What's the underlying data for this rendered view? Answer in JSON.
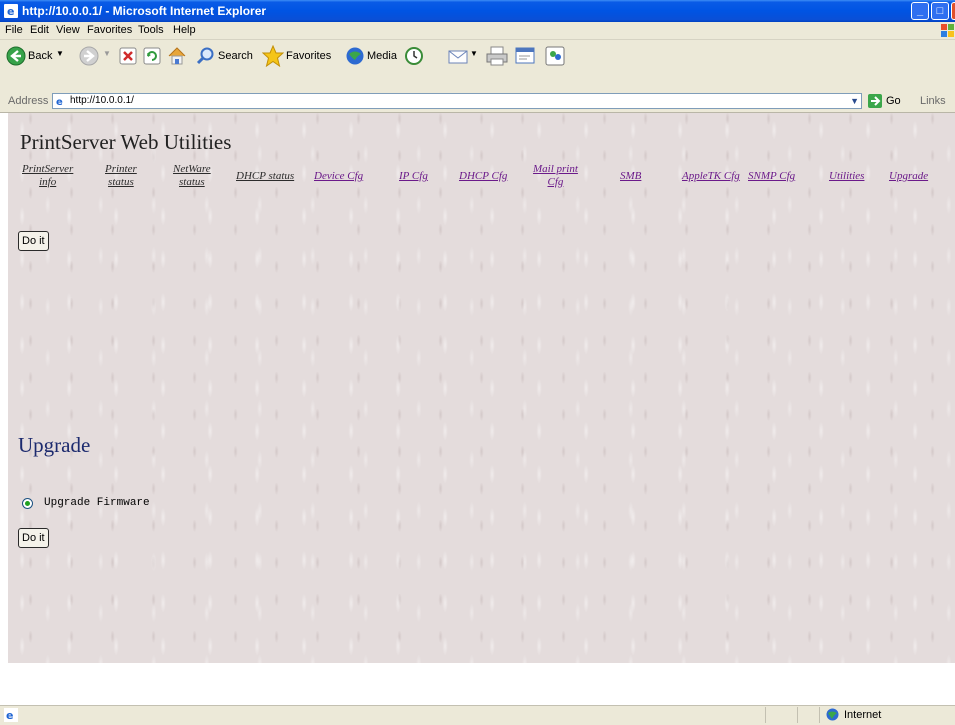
{
  "window": {
    "title": "http://10.0.0.1/ - Microsoft Internet Explorer",
    "buttons": {
      "minimize": "_",
      "maximize": "□",
      "close": "X"
    }
  },
  "menu": [
    "File",
    "Edit",
    "View",
    "Favorites",
    "Tools",
    "Help"
  ],
  "toolbar": {
    "back": "Back",
    "search": "Search",
    "favorites": "Favorites",
    "media": "Media",
    "icons": [
      "back-arrow-icon",
      "forward-arrow-icon",
      "stop-icon",
      "refresh-icon",
      "home-icon",
      "search-icon",
      "favorites-star-icon",
      "media-icon",
      "history-icon",
      "mail-icon",
      "print-icon",
      "edit-icon",
      "messenger-icon"
    ]
  },
  "address": {
    "label": "Address",
    "value": "http://10.0.0.1/",
    "go": "Go",
    "links": "Links"
  },
  "page": {
    "title": "PrintServer  Web  Utilities",
    "nav": [
      {
        "label_lines": [
          "PrintServer",
          "info"
        ],
        "visited": true
      },
      {
        "label_lines": [
          "Printer",
          "status"
        ],
        "visited": true
      },
      {
        "label_lines": [
          "NetWare",
          "status"
        ],
        "visited": true
      },
      {
        "label_lines": [
          "DHCP status"
        ],
        "visited": true
      },
      {
        "label_lines": [
          "Device Cfg"
        ],
        "visited": false
      },
      {
        "label_lines": [
          "IP Cfg"
        ],
        "visited": false
      },
      {
        "label_lines": [
          "DHCP Cfg"
        ],
        "visited": false
      },
      {
        "label_lines": [
          "Mail print",
          "Cfg"
        ],
        "visited": false
      },
      {
        "label_lines": [
          "SMB"
        ],
        "visited": false
      },
      {
        "label_lines": [
          "AppleTK Cfg"
        ],
        "visited": false
      },
      {
        "label_lines": [
          "SNMP Cfg"
        ],
        "visited": false
      },
      {
        "label_lines": [
          "Utilities"
        ],
        "visited": false
      },
      {
        "label_lines": [
          "Upgrade"
        ],
        "visited": false
      }
    ],
    "do_it_1": "Do it",
    "upgrade_heading": "Upgrade",
    "radio_label": "Upgrade Firmware",
    "radio_checked": true,
    "do_it_2": "Do it"
  },
  "status": {
    "zone": "Internet"
  },
  "colors": {
    "visited_link": "#2c2c2c",
    "unvisited_link": "#6b1a8a",
    "heading": "#1c2a6e"
  }
}
